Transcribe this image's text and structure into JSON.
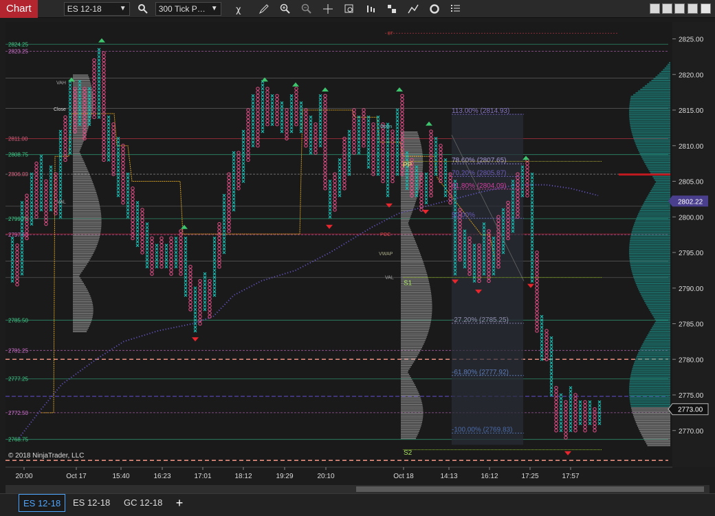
{
  "window": {
    "title": "Chart"
  },
  "toolbar": {
    "instrument": "ES 12-18",
    "period": "300 Tick P…",
    "icons": [
      "search-icon",
      "strategy-icon",
      "draw-icon",
      "zoom-in-icon",
      "zoom-out-icon",
      "crosshair-icon",
      "data-box-icon",
      "bar-type-icon",
      "indicators-icon",
      "drawing-tools-icon",
      "reload-icon",
      "properties-icon"
    ]
  },
  "price_axis": {
    "labels": [
      "2825.00",
      "2820.00",
      "2815.00",
      "2810.00",
      "2805.00",
      "2800.00",
      "2795.00",
      "2790.00",
      "2785.00",
      "2780.00",
      "2775.00",
      "2770.00"
    ],
    "current_price": "2802.22",
    "last_price": "2773.00"
  },
  "time_axis": {
    "labels": [
      "20:00",
      "Oct 17",
      "15:40",
      "16:23",
      "17:01",
      "18:12",
      "19:29",
      "20:10",
      "Oct 18",
      "14:13",
      "16:12",
      "17:25",
      "17:57"
    ]
  },
  "left_levels": [
    "2824.25",
    "2823.25",
    "2811.00",
    "2808.75",
    "2806.00",
    "2799.75",
    "2797.50",
    "2785.50",
    "2781.25",
    "2777.25",
    "2772.50",
    "2768.75"
  ],
  "profile_labels": {
    "vah": "VAH",
    "close": "Close",
    "poc": "POC",
    "val": "VAL",
    "open": "Open",
    "vwap": "VWAP",
    "bt": "BT"
  },
  "pivots": {
    "pp": "PP",
    "s1": "S1",
    "s2": "S2"
  },
  "fib_levels": [
    "113.00% (2814.93)",
    "78.60% (2807.65)",
    "70.20% (2805.87)",
    "61.80% (2804.09)",
    "50.00%",
    "-27.20% (2785.25)",
    "-61.80% (2777.92)",
    "-100.00% (2769.83)"
  ],
  "copyright": "© 2018 NinjaTrader, LLC",
  "tabs": [
    {
      "label": "ES 12-18",
      "active": true
    },
    {
      "label": "ES 12-18",
      "active": false
    },
    {
      "label": "GC 12-18",
      "active": false
    }
  ],
  "colors": {
    "background": "#1c1c1c",
    "x_column": "#21b8b0",
    "o_column": "#e8508a",
    "up_marker": "#3ec46d",
    "down_marker": "#e8262e",
    "profile": "#9a9a9a",
    "profile_teal": "#1b7e78",
    "vwap": "#6b5bd6",
    "pivot_line": "#d3a020",
    "current_price_box": "#4a3f8c"
  }
}
